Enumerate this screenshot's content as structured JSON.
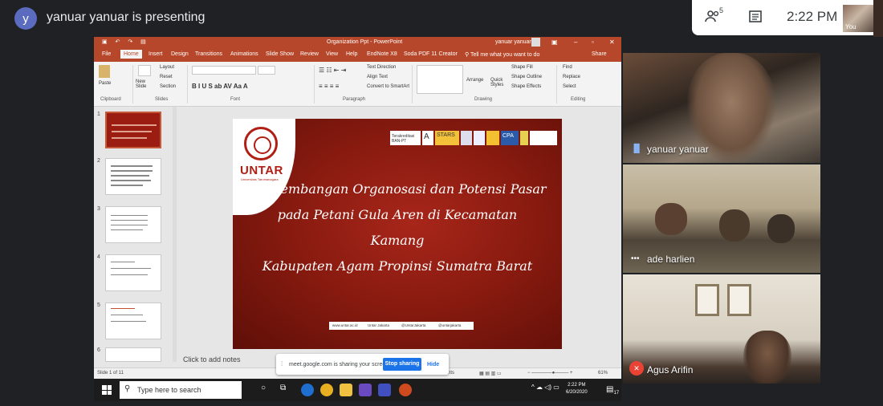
{
  "meet": {
    "presenter_initial": "y",
    "presenting_text": "yanuar yanuar is presenting",
    "participant_count": "5",
    "time": "2:22 PM",
    "self_label": "You"
  },
  "powerpoint": {
    "window_title": "Organization Ppt - PowerPoint",
    "user_name": "yanuar yanuar",
    "tabs": [
      "File",
      "Home",
      "Insert",
      "Design",
      "Transitions",
      "Animations",
      "Slide Show",
      "Review",
      "View",
      "Help",
      "EndNote X8",
      "Soda PDF 11 Creator"
    ],
    "tell_me": "Tell me what you want to do",
    "share": "Share",
    "ribbon": {
      "paste": "Paste",
      "new_slide": "New Slide",
      "layout": "Layout",
      "reset": "Reset",
      "section": "Section",
      "text_direction": "Text Direction",
      "align_text": "Align Text",
      "convert_smartart": "Convert to SmartArt",
      "arrange": "Arrange",
      "quick_styles": "Quick Styles",
      "shape_fill": "Shape Fill",
      "shape_outline": "Shape Outline",
      "shape_effects": "Shape Effects",
      "find": "Find",
      "replace": "Replace",
      "select": "Select",
      "groups": [
        "Clipboard",
        "Slides",
        "Font",
        "Paragraph",
        "Drawing",
        "Editing"
      ]
    },
    "thumbnails": [
      "1",
      "2",
      "3",
      "4",
      "5",
      "6"
    ],
    "slide": {
      "logo_text": "UNTAR",
      "logo_sub": "Universitas Tarumanagara",
      "badges": [
        "Terakreditasi BAN-PT",
        "A",
        "STARS",
        "CPA"
      ],
      "lines": [
        "Pengembangan Organosasi dan Potensi Pasar",
        "pada Petani Gula Aren di Kecamatan",
        "Kamang",
        "Kabupaten Agam Propinsi Sumatra Barat"
      ],
      "footer": [
        "www.untar.ac.id",
        "Untar Jakarta",
        "@UntarJakarta",
        "@untarjakarta"
      ]
    },
    "notes_placeholder": "Click to add notes",
    "status": {
      "slide_counter": "Slide 1 of 11",
      "comments": "Comments",
      "zoom": "61%"
    }
  },
  "taskbar": {
    "search_placeholder": "Type here to search",
    "time": "2:22 PM",
    "date": "6/20/2020",
    "notif_count": "17"
  },
  "share_toast": {
    "message": "meet.google.com is sharing your screen.",
    "stop": "Stop sharing",
    "hide": "Hide"
  },
  "participants": [
    {
      "name": "yanuar yanuar"
    },
    {
      "name": "ade harlien"
    },
    {
      "name": "Agus Arifin"
    }
  ]
}
